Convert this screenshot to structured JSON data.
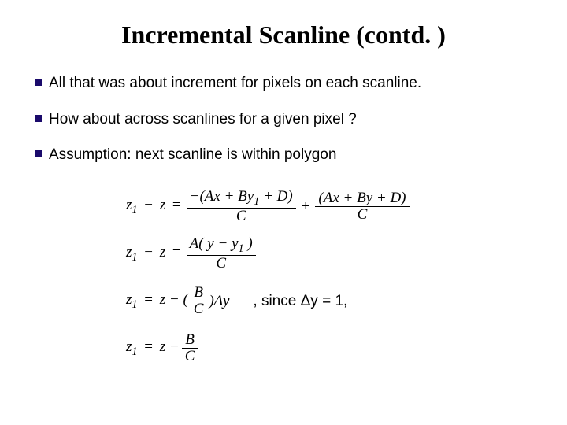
{
  "slide": {
    "title": "Incremental Scanline (contd. )",
    "bullets": [
      "All that was about increment for pixels on each scanline.",
      "How about across scanlines for a given pixel ?",
      "Assumption: next scanline is within polygon"
    ],
    "equations": {
      "eq1": {
        "lhs_a": "z",
        "lhs_sub": "1",
        "minus": "−",
        "lhs_b": "z",
        "eq": "=",
        "f1_num": "−(Ax + By",
        "f1_num_sub": "1",
        "f1_num_tail": " + D)",
        "f1_den": "C",
        "plus": "+",
        "f2_num": "(Ax + By + D)",
        "f2_den": "C"
      },
      "eq2": {
        "lhs_a": "z",
        "lhs_sub": "1",
        "minus": "−",
        "lhs_b": "z",
        "eq": "=",
        "f_num_a": "A( y − y",
        "f_num_sub": "1",
        "f_num_b": " )",
        "f_den": "C"
      },
      "eq3": {
        "lhs_a": "z",
        "lhs_sub": "1",
        "eq": "=",
        "rhs_a": "z − (",
        "f_num": "B",
        "f_den": "C",
        "rhs_b": ")Δy",
        "annot": ", since Δy = 1,"
      },
      "eq4": {
        "lhs_a": "z",
        "lhs_sub": "1",
        "eq": "=",
        "rhs_a": "z −",
        "f_num": "B",
        "f_den": "C"
      }
    }
  }
}
